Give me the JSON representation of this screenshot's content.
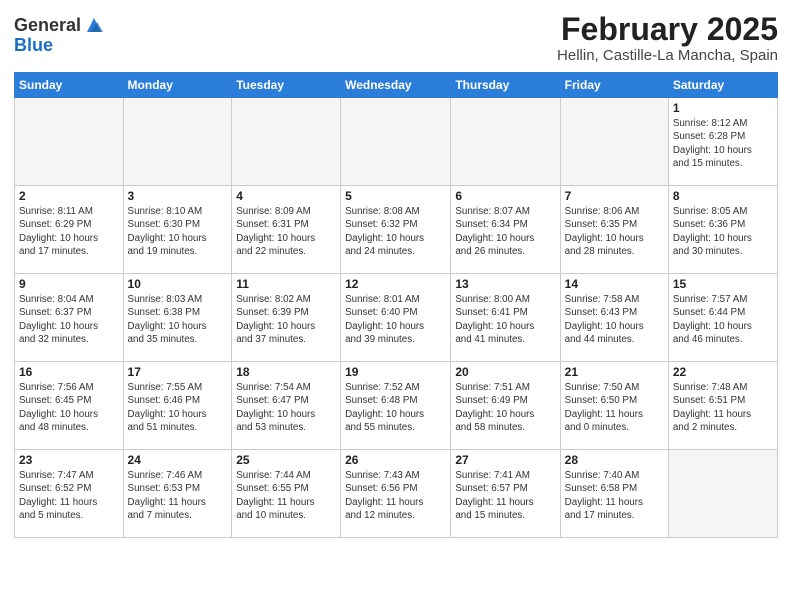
{
  "header": {
    "logo_line1": "General",
    "logo_line2": "Blue",
    "title": "February 2025",
    "subtitle": "Hellin, Castille-La Mancha, Spain"
  },
  "weekdays": [
    "Sunday",
    "Monday",
    "Tuesday",
    "Wednesday",
    "Thursday",
    "Friday",
    "Saturday"
  ],
  "weeks": [
    [
      {
        "day": "",
        "info": ""
      },
      {
        "day": "",
        "info": ""
      },
      {
        "day": "",
        "info": ""
      },
      {
        "day": "",
        "info": ""
      },
      {
        "day": "",
        "info": ""
      },
      {
        "day": "",
        "info": ""
      },
      {
        "day": "1",
        "info": "Sunrise: 8:12 AM\nSunset: 6:28 PM\nDaylight: 10 hours\nand 15 minutes."
      }
    ],
    [
      {
        "day": "2",
        "info": "Sunrise: 8:11 AM\nSunset: 6:29 PM\nDaylight: 10 hours\nand 17 minutes."
      },
      {
        "day": "3",
        "info": "Sunrise: 8:10 AM\nSunset: 6:30 PM\nDaylight: 10 hours\nand 19 minutes."
      },
      {
        "day": "4",
        "info": "Sunrise: 8:09 AM\nSunset: 6:31 PM\nDaylight: 10 hours\nand 22 minutes."
      },
      {
        "day": "5",
        "info": "Sunrise: 8:08 AM\nSunset: 6:32 PM\nDaylight: 10 hours\nand 24 minutes."
      },
      {
        "day": "6",
        "info": "Sunrise: 8:07 AM\nSunset: 6:34 PM\nDaylight: 10 hours\nand 26 minutes."
      },
      {
        "day": "7",
        "info": "Sunrise: 8:06 AM\nSunset: 6:35 PM\nDaylight: 10 hours\nand 28 minutes."
      },
      {
        "day": "8",
        "info": "Sunrise: 8:05 AM\nSunset: 6:36 PM\nDaylight: 10 hours\nand 30 minutes."
      }
    ],
    [
      {
        "day": "9",
        "info": "Sunrise: 8:04 AM\nSunset: 6:37 PM\nDaylight: 10 hours\nand 32 minutes."
      },
      {
        "day": "10",
        "info": "Sunrise: 8:03 AM\nSunset: 6:38 PM\nDaylight: 10 hours\nand 35 minutes."
      },
      {
        "day": "11",
        "info": "Sunrise: 8:02 AM\nSunset: 6:39 PM\nDaylight: 10 hours\nand 37 minutes."
      },
      {
        "day": "12",
        "info": "Sunrise: 8:01 AM\nSunset: 6:40 PM\nDaylight: 10 hours\nand 39 minutes."
      },
      {
        "day": "13",
        "info": "Sunrise: 8:00 AM\nSunset: 6:41 PM\nDaylight: 10 hours\nand 41 minutes."
      },
      {
        "day": "14",
        "info": "Sunrise: 7:58 AM\nSunset: 6:43 PM\nDaylight: 10 hours\nand 44 minutes."
      },
      {
        "day": "15",
        "info": "Sunrise: 7:57 AM\nSunset: 6:44 PM\nDaylight: 10 hours\nand 46 minutes."
      }
    ],
    [
      {
        "day": "16",
        "info": "Sunrise: 7:56 AM\nSunset: 6:45 PM\nDaylight: 10 hours\nand 48 minutes."
      },
      {
        "day": "17",
        "info": "Sunrise: 7:55 AM\nSunset: 6:46 PM\nDaylight: 10 hours\nand 51 minutes."
      },
      {
        "day": "18",
        "info": "Sunrise: 7:54 AM\nSunset: 6:47 PM\nDaylight: 10 hours\nand 53 minutes."
      },
      {
        "day": "19",
        "info": "Sunrise: 7:52 AM\nSunset: 6:48 PM\nDaylight: 10 hours\nand 55 minutes."
      },
      {
        "day": "20",
        "info": "Sunrise: 7:51 AM\nSunset: 6:49 PM\nDaylight: 10 hours\nand 58 minutes."
      },
      {
        "day": "21",
        "info": "Sunrise: 7:50 AM\nSunset: 6:50 PM\nDaylight: 11 hours\nand 0 minutes."
      },
      {
        "day": "22",
        "info": "Sunrise: 7:48 AM\nSunset: 6:51 PM\nDaylight: 11 hours\nand 2 minutes."
      }
    ],
    [
      {
        "day": "23",
        "info": "Sunrise: 7:47 AM\nSunset: 6:52 PM\nDaylight: 11 hours\nand 5 minutes."
      },
      {
        "day": "24",
        "info": "Sunrise: 7:46 AM\nSunset: 6:53 PM\nDaylight: 11 hours\nand 7 minutes."
      },
      {
        "day": "25",
        "info": "Sunrise: 7:44 AM\nSunset: 6:55 PM\nDaylight: 11 hours\nand 10 minutes."
      },
      {
        "day": "26",
        "info": "Sunrise: 7:43 AM\nSunset: 6:56 PM\nDaylight: 11 hours\nand 12 minutes."
      },
      {
        "day": "27",
        "info": "Sunrise: 7:41 AM\nSunset: 6:57 PM\nDaylight: 11 hours\nand 15 minutes."
      },
      {
        "day": "28",
        "info": "Sunrise: 7:40 AM\nSunset: 6:58 PM\nDaylight: 11 hours\nand 17 minutes."
      },
      {
        "day": "",
        "info": ""
      }
    ]
  ]
}
